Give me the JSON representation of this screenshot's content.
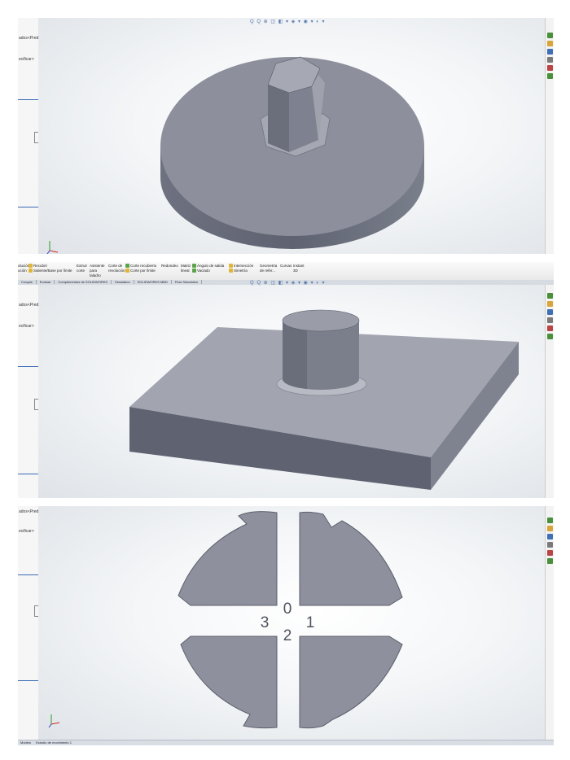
{
  "app": "SOLIDWORKS",
  "panels": [
    {
      "name": "hex-boss-on-disc",
      "tree_text": [
        "ados<Pred",
        "ecificar>"
      ],
      "view_toolbar": "Q Q ⊕ ◫ ◧ ▾ ◈ ▾ ◉ ▾ ◐ ▾"
    },
    {
      "name": "cylinder-boss-on-plate",
      "tree_text": [
        "ados<Pred",
        "ecificar>"
      ],
      "view_toolbar": "Q Q ⊕ ◫ ◧ ▾ ◈ ▾ ◉ ▾ ◐ ▾",
      "ribbon": {
        "col1": [
          "olución",
          "ución"
        ],
        "col2": [
          "Recubrir",
          "Saliente/Base por límite"
        ],
        "col3": [
          "Extruir",
          "corte"
        ],
        "col4": [
          "Asistente",
          "para",
          "taladro"
        ],
        "col5": [
          "Corte de",
          "revolución"
        ],
        "col6": [
          "Corte recubierto",
          "Corte por límite"
        ],
        "col7": [
          "Redondeo"
        ],
        "col8": [
          "Matriz",
          "lineal"
        ],
        "col9": [
          "Ángulo de salida",
          "Vaciado"
        ],
        "col10": [
          "Intersección",
          "Simetría"
        ],
        "col11": [
          "Geometría",
          "de refer..."
        ],
        "col12": [
          "Curvas"
        ],
        "col13": [
          "Instant",
          "3D"
        ]
      },
      "tabs": [
        "Croquis",
        "Evaluar",
        "Complementos de SOLIDWORKS",
        "Simulation",
        "SOLIDWORKS MBD",
        "Flow Simulation"
      ]
    },
    {
      "name": "cross-slotted-disc",
      "tree_text": [
        "ados<Pred",
        "ecificar>"
      ],
      "engraved_numbers": [
        "0",
        "1",
        "2",
        "3"
      ],
      "status_tabs": [
        "Modelo",
        "Estudio de movimiento 1"
      ]
    }
  ]
}
